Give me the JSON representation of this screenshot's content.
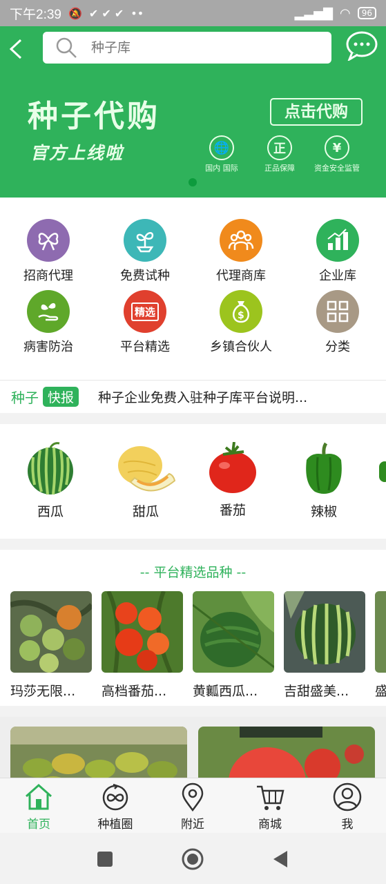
{
  "statusbar": {
    "time": "下午2:39",
    "battery": "96"
  },
  "header": {
    "search_placeholder": "种子库"
  },
  "banner": {
    "title": "种子代购",
    "subtitle": "官方上线啦",
    "button": "点击代购",
    "badges": [
      {
        "glyph": "🌐",
        "label": "国内 国际"
      },
      {
        "glyph": "正",
        "label": "正品保障"
      },
      {
        "glyph": "¥",
        "label": "资金安全监管"
      }
    ]
  },
  "grid": [
    {
      "label": "招商代理",
      "color": "#8e6bb0",
      "icon": "bow-icon"
    },
    {
      "label": "免费试种",
      "color": "#3db7b7",
      "icon": "sprout-icon"
    },
    {
      "label": "代理商库",
      "color": "#f08a1c",
      "icon": "group-icon"
    },
    {
      "label": "企业库",
      "color": "#2fb25b",
      "icon": "bar-chart-icon"
    },
    {
      "label": "病害防治",
      "color": "#5fa82a",
      "icon": "plant-hand-icon"
    },
    {
      "label": "平台精选",
      "color": "#e0402e",
      "icon": "selected-tag-icon",
      "tag": "精选"
    },
    {
      "label": "乡镇合伙人",
      "color": "#9cc41e",
      "icon": "money-bag-icon"
    },
    {
      "label": "分类",
      "color": "#a89985",
      "icon": "category-grid-icon"
    }
  ],
  "news": {
    "k1": "种子",
    "k2": "快报",
    "text": "种子企业免费入驻种子库平台说明..."
  },
  "fruits": [
    {
      "label": "西瓜"
    },
    {
      "label": "甜瓜"
    },
    {
      "label": "番茄"
    },
    {
      "label": "辣椒"
    }
  ],
  "picks": {
    "title": "-- 平台精选品种 --",
    "items": [
      {
        "label": "玛莎无限..."
      },
      {
        "label": "高档番茄..."
      },
      {
        "label": "黄瓤西瓜..."
      },
      {
        "label": "吉甜盛美..."
      },
      {
        "label": "盛"
      }
    ]
  },
  "tabbar": [
    {
      "label": "首页"
    },
    {
      "label": "种植圈"
    },
    {
      "label": "附近"
    },
    {
      "label": "商城"
    },
    {
      "label": "我"
    }
  ],
  "colors": {
    "brand_green": "#2fb25b"
  }
}
